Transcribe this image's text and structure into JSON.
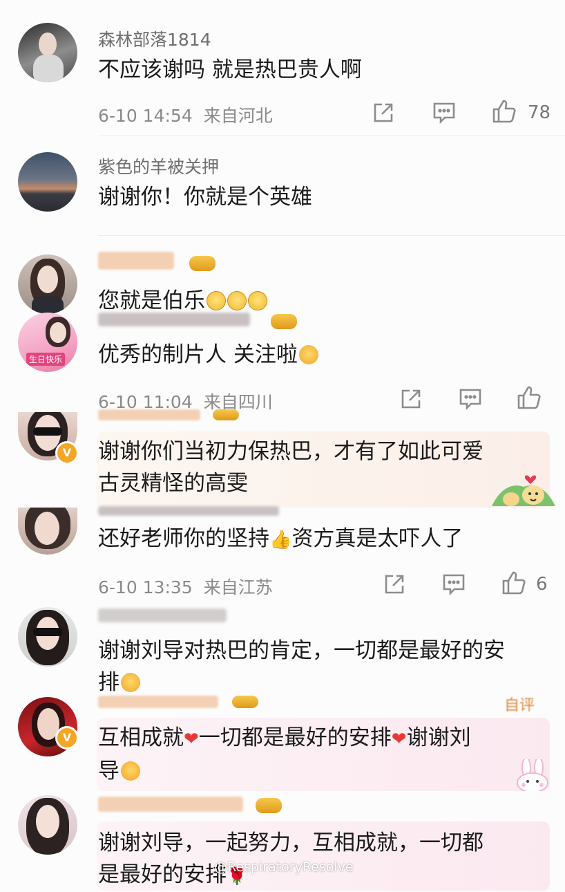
{
  "comments": [
    {
      "username": "森林部落1814",
      "text": "不应该谢吗 就是热巴贵人啊",
      "time": "6-10 14:54",
      "location": "来自河北",
      "likes": "78"
    },
    {
      "username": "紫色的羊被关押",
      "text": "谢谢你！你就是个英雄"
    },
    {
      "username": "",
      "text": "您就是伯乐"
    },
    {
      "username": "",
      "text": "优秀的制片人 关注啦",
      "time": "6-10 11:04",
      "location": "来自四川",
      "avatar_text": "生日快乐"
    },
    {
      "username": "",
      "text_line1": "谢谢你们当初力保热巴，才有了如此可爱",
      "text_line2": "古灵精怪的高雯",
      "verified": "V"
    },
    {
      "username": "",
      "text_a": "还好老师你的坚持",
      "text_b": "资方真是太吓人了",
      "time": "6-10 13:35",
      "location": "来自江苏",
      "likes": "6"
    },
    {
      "username": "",
      "text_line1": "谢谢刘导对热巴的肯定，一切都是最好的安",
      "text_line2": "排"
    },
    {
      "username": "",
      "text_a": "互相成就",
      "text_b": "一切都是最好的安排",
      "text_c": "谢谢刘",
      "text_line2": "导",
      "verified": "V",
      "top_right_label": "自评"
    },
    {
      "username": "",
      "text_line1": "谢谢刘导，一起努力，互相成就，一切都",
      "text_line2": "是最好的安排"
    }
  ],
  "watermark": "@RespiratoryResolve",
  "icons": {
    "share": "share-icon",
    "comment": "comment-icon",
    "like": "thumbs-up-icon"
  },
  "colors": {
    "meta_gray": "#8a8a8a",
    "username_gray": "#6e6e6e",
    "fan_name_orange": "#e08a3c",
    "verified_orange": "#f5a623",
    "heart_red": "#e53935"
  }
}
